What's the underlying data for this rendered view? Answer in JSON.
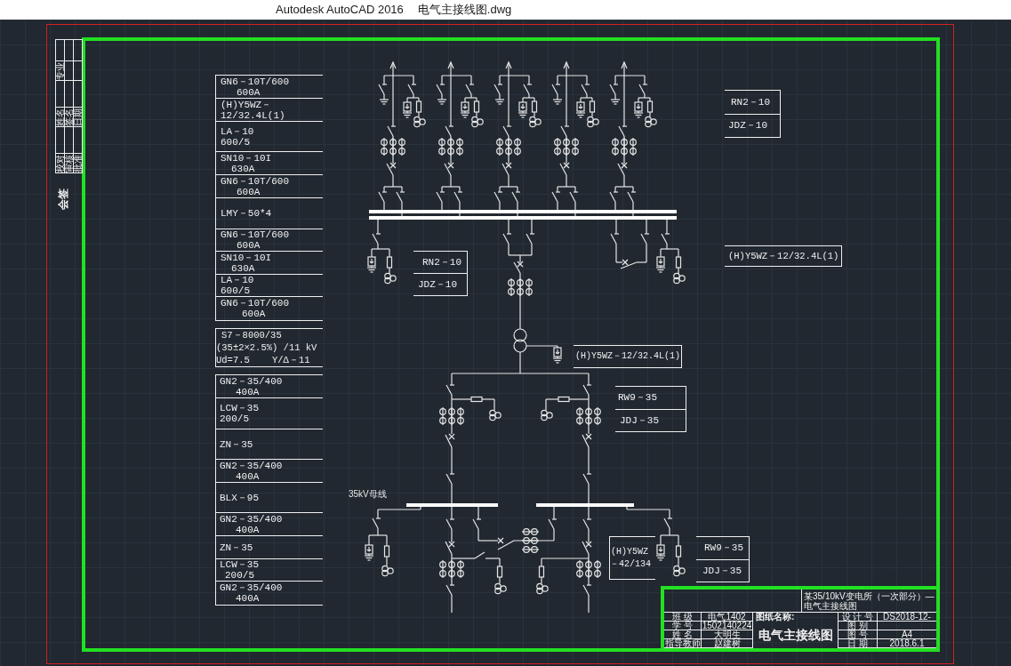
{
  "window": {
    "title": "Autodesk AutoCAD 2016",
    "file_name": "电气主接线图.dwg"
  },
  "signoff_table": {
    "caption": "会签",
    "rows": [
      {
        "cells": [
          "专业"
        ]
      },
      {
        "cells": [
          "姓名",
          "签名",
          "日期"
        ]
      },
      {
        "cells": [
          "校对",
          "审核",
          "批准"
        ]
      }
    ]
  },
  "equipment_table": {
    "groups": [
      {
        "rows": [
          {
            "lines": [
              "GN6－10T/600",
              "600A"
            ]
          },
          {
            "lines": [
              "(H)Y5WZ－",
              "12/32.4L(1)"
            ]
          },
          {
            "lines": [
              "LA－10",
              "600/5"
            ]
          },
          {
            "lines": [
              "SN10－10I",
              "630A"
            ]
          },
          {
            "lines": [
              "GN6－10T/600",
              "600A"
            ]
          },
          {
            "lines": [
              "LMY－50*4"
            ]
          },
          {
            "lines": [
              "GN6－10T/600",
              "600A"
            ]
          },
          {
            "lines": [
              "SN10－10I",
              "630A"
            ]
          },
          {
            "lines": [
              "LA－10",
              "600/5"
            ]
          },
          {
            "lines": [
              "GN6－10T/600",
              "600A"
            ]
          }
        ]
      },
      {
        "rows": [
          {
            "lines": [
              "S7－8000/35",
              "(35±2×2.5%) /11 kV",
              "Ud=7.5    Y/Δ－11"
            ]
          }
        ]
      },
      {
        "rows": [
          {
            "lines": [
              "GN2－35/400",
              "400A"
            ]
          },
          {
            "lines": [
              "LCW－35",
              "200/5"
            ]
          },
          {
            "lines": [
              "ZN－35"
            ]
          },
          {
            "lines": [
              "GN2－35/400",
              "400A"
            ]
          },
          {
            "lines": [
              "BLX－95"
            ]
          },
          {
            "lines": [
              "GN2－35/400",
              "400A"
            ]
          },
          {
            "lines": [
              "ZN－35"
            ]
          },
          {
            "lines": [
              "LCW－35",
              "200/5"
            ]
          },
          {
            "lines": [
              "GN2－35/400",
              "400A"
            ]
          }
        ]
      }
    ]
  },
  "diagram": {
    "callouts": [
      {
        "kind": "table",
        "lines": [
          "RN2－10",
          "JDZ－10"
        ]
      },
      {
        "kind": "table",
        "lines": [
          "(H)Y5WZ－12/32.4L(1)"
        ]
      },
      {
        "kind": "table",
        "lines": [
          "RN2－10",
          "JDZ－10"
        ]
      },
      {
        "kind": "table",
        "lines": [
          "(H)Y5WZ－12/32.4L(1)"
        ]
      },
      {
        "kind": "table",
        "lines": [
          "RW9－35",
          "JDJ－35"
        ]
      },
      {
        "kind": "note",
        "lines": [
          "(H)Y5WZ",
          "－42/134"
        ]
      },
      {
        "kind": "table",
        "lines": [
          "RW9－35",
          "JDJ－35"
        ]
      }
    ],
    "bus_label": "35kV母线"
  },
  "title_block": {
    "project_title": "某35/10kV变电所（一次部分）—电气主接线图",
    "drawing_caption": "图纸名称:",
    "drawing_title": "电气主接线图",
    "left_fields": [
      {
        "label": "班 级",
        "value": "电气1402"
      },
      {
        "label": "学 号",
        "value": "1502140224"
      },
      {
        "label": "姓 名",
        "value": "大明生"
      },
      {
        "label": "指导教师",
        "value": "赵建树"
      }
    ],
    "right_fields": [
      {
        "label": "设 计 号",
        "value": "DS2018-12-"
      },
      {
        "label": "图 别"
      },
      {
        "label": "图 号",
        "value": "A4"
      },
      {
        "label": "日 期",
        "value": "2018.6.1"
      }
    ]
  }
}
